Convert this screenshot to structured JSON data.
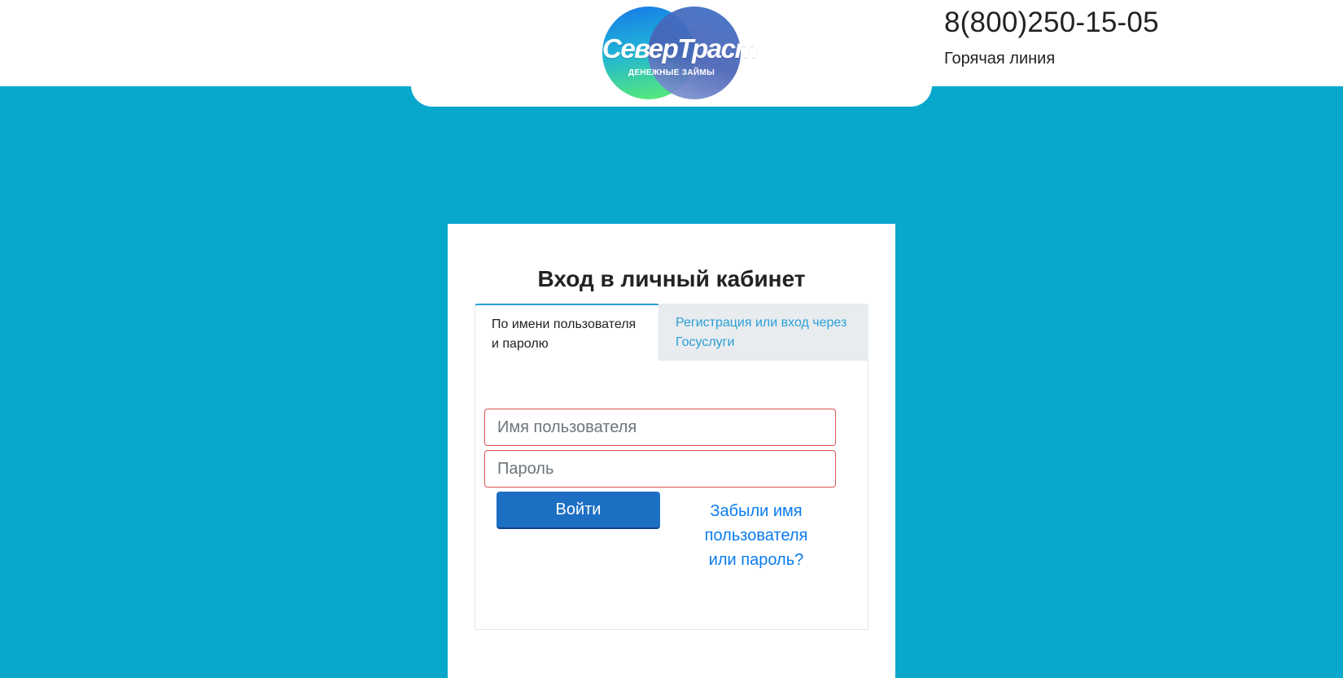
{
  "header": {
    "logo": {
      "brand": "СеверТраст",
      "tagline": "ДЕНЕЖНЫЕ ЗАЙМЫ"
    },
    "phone": "8(800)250-15-05",
    "hotline_label": "Горячая линия"
  },
  "login": {
    "title": "Вход в личный кабинет",
    "tabs": [
      {
        "label": "По имени пользователя и паролю",
        "active": true
      },
      {
        "label": "Регистрация или вход через Госуслуги",
        "active": false
      }
    ],
    "username_placeholder": "Имя пользователя",
    "password_placeholder": "Пароль",
    "submit_label": "Войти",
    "forgot_link": "Забыли имя пользователя или пароль?"
  },
  "colors": {
    "background": "#08a8cc",
    "primary_button": "#1d6fc4",
    "link": "#0a7cf0",
    "tab_link": "#2a9fd6",
    "field_border_error": "#d9534f"
  }
}
